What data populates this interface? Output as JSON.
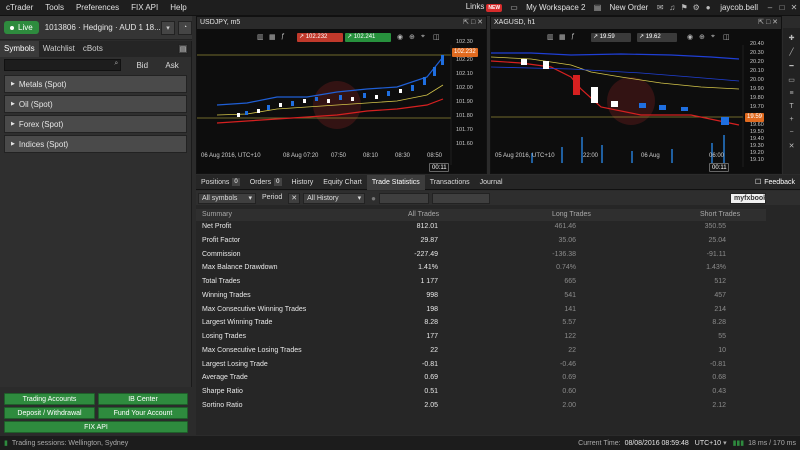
{
  "menu": [
    "cTrader",
    "Tools",
    "Preferences",
    "FIX API",
    "Help"
  ],
  "topbar": {
    "links": "Links",
    "new_badge": "NEW",
    "workspace": "My Workspace 2",
    "new_order": "New Order",
    "user": "jaycob.bell"
  },
  "account": {
    "live_label": "Live",
    "info": "1013806 · Hedging · AUD 1 18..."
  },
  "left": {
    "tabs": [
      "Symbols",
      "Watchlist",
      "cBots"
    ],
    "bid": "Bid",
    "ask": "Ask",
    "categories": [
      "Metals (Spot)",
      "Oil (Spot)",
      "Forex (Spot)",
      "Indices (Spot)"
    ]
  },
  "buttons": {
    "trading_accounts": "Trading Accounts",
    "ib_center": "IB Center",
    "deposit": "Deposit / Withdrawal",
    "fund": "Fund Your Account",
    "fix_api": "FIX API"
  },
  "chart1": {
    "title": "USDJPY, m5",
    "sell": "102.232",
    "buy": "102.241",
    "price_tag": "102.232",
    "axis": [
      "102.30",
      "102.20",
      "102.10",
      "102.00",
      "101.90",
      "101.80",
      "101.70",
      "101.60"
    ],
    "times": [
      "06 Aug 2016, UTC+10",
      "08 Aug 07:20",
      "07:50",
      "08:10",
      "08:30",
      "08:50"
    ],
    "countdown": "00:11"
  },
  "chart2": {
    "title": "XAGUSD, h1",
    "sell": "19.59",
    "buy": "19.62",
    "price_tag": "19.59",
    "axis": [
      "20.40",
      "20.30",
      "20.20",
      "20.10",
      "20.00",
      "19.90",
      "19.80",
      "19.70",
      "19.60",
      "19.50",
      "19.40",
      "19.30",
      "19.20",
      "19.10"
    ],
    "times": [
      "05 Aug 2016, UTC+10",
      "22:00",
      "06 Aug",
      "06:00"
    ],
    "countdown": "00:11"
  },
  "bottom_tabs": {
    "positions": "Positions",
    "positions_count": "0",
    "orders": "Orders",
    "orders_count": "0",
    "history": "History",
    "equity": "Equity Chart",
    "trade_stats": "Trade Statistics",
    "transactions": "Transactions",
    "journal": "Journal",
    "feedback": "Feedback"
  },
  "filters": {
    "symbols": "All symbols",
    "period_label": "Period",
    "period": "All History",
    "myfxbook": "myfxbook"
  },
  "stats_headers": [
    "Summary",
    "All Trades",
    "Long Trades",
    "Short Trades"
  ],
  "stats": [
    {
      "label": "Net Profit",
      "all": "812.01",
      "long": "461.46",
      "short": "350.55"
    },
    {
      "label": "Profit Factor",
      "all": "29.87",
      "long": "35.06",
      "short": "25.04"
    },
    {
      "label": "Commission",
      "all": "-227.49",
      "long": "-136.38",
      "short": "-91.11"
    },
    {
      "label": "Max Balance Drawdown",
      "all": "1.41%",
      "long": "0.74%",
      "short": "1.43%"
    },
    {
      "label": "Total Trades",
      "all": "1 177",
      "long": "665",
      "short": "512"
    },
    {
      "label": "Winning Trades",
      "all": "998",
      "long": "541",
      "short": "457"
    },
    {
      "label": "Max Consecutive Winning Trades",
      "all": "198",
      "long": "141",
      "short": "214"
    },
    {
      "label": "Largest Winning Trade",
      "all": "8.28",
      "long": "5.57",
      "short": "8.28"
    },
    {
      "label": "Losing Trades",
      "all": "177",
      "long": "122",
      "short": "55"
    },
    {
      "label": "Max Consecutive Losing Trades",
      "all": "22",
      "long": "22",
      "short": "10"
    },
    {
      "label": "Largest Losing Trade",
      "all": "-0.81",
      "long": "-0.46",
      "short": "-0.81"
    },
    {
      "label": "Average Trade",
      "all": "0.69",
      "long": "0.69",
      "short": "0.68"
    },
    {
      "label": "Sharpe Ratio",
      "all": "0.51",
      "long": "0.60",
      "short": "0.43"
    },
    {
      "label": "Sortino Ratio",
      "all": "2.05",
      "long": "2.00",
      "short": "2.12"
    }
  ],
  "statusbar": {
    "sessions": "Trading sessions: Wellington, Sydney",
    "current_time_label": "Current Time:",
    "current_time": "08/08/2016 08:59:48",
    "tz": "UTC+10",
    "latency": "18 ms / 170 ms"
  }
}
